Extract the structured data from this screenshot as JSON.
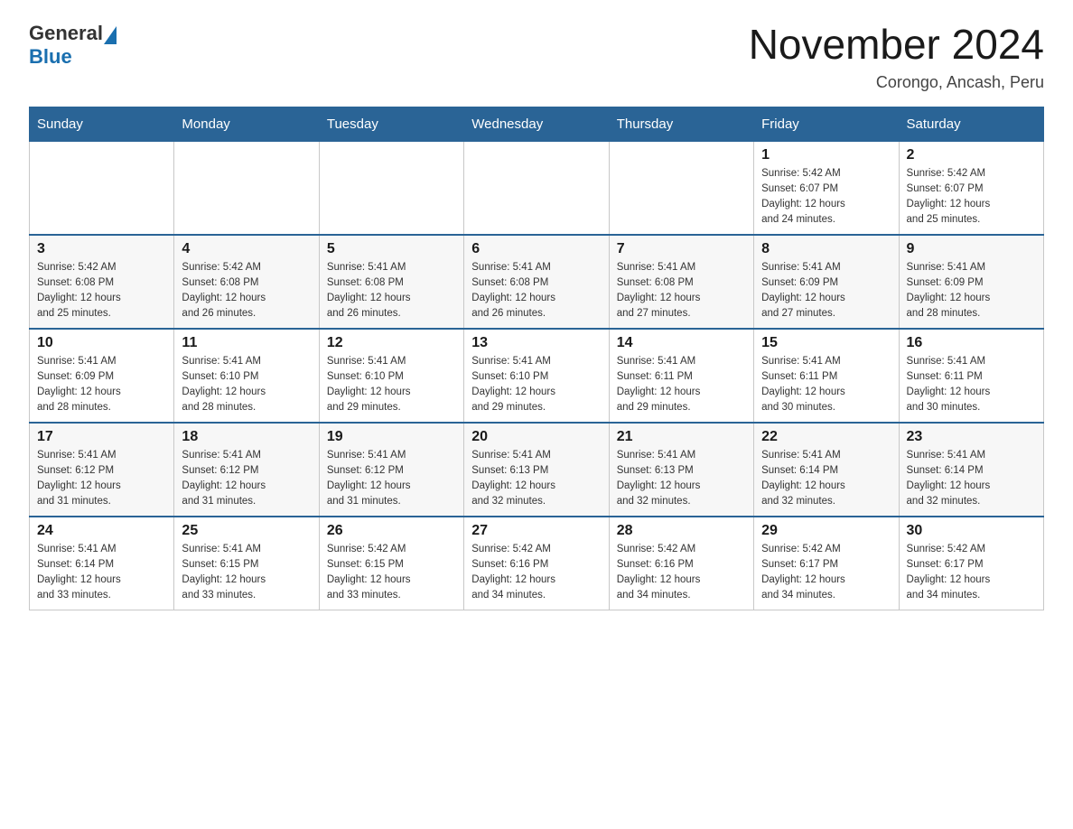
{
  "header": {
    "title": "November 2024",
    "subtitle": "Corongo, Ancash, Peru",
    "logo_general": "General",
    "logo_blue": "Blue"
  },
  "weekdays": [
    "Sunday",
    "Monday",
    "Tuesday",
    "Wednesday",
    "Thursday",
    "Friday",
    "Saturday"
  ],
  "weeks": [
    [
      {
        "day": "",
        "info": ""
      },
      {
        "day": "",
        "info": ""
      },
      {
        "day": "",
        "info": ""
      },
      {
        "day": "",
        "info": ""
      },
      {
        "day": "",
        "info": ""
      },
      {
        "day": "1",
        "info": "Sunrise: 5:42 AM\nSunset: 6:07 PM\nDaylight: 12 hours\nand 24 minutes."
      },
      {
        "day": "2",
        "info": "Sunrise: 5:42 AM\nSunset: 6:07 PM\nDaylight: 12 hours\nand 25 minutes."
      }
    ],
    [
      {
        "day": "3",
        "info": "Sunrise: 5:42 AM\nSunset: 6:08 PM\nDaylight: 12 hours\nand 25 minutes."
      },
      {
        "day": "4",
        "info": "Sunrise: 5:42 AM\nSunset: 6:08 PM\nDaylight: 12 hours\nand 26 minutes."
      },
      {
        "day": "5",
        "info": "Sunrise: 5:41 AM\nSunset: 6:08 PM\nDaylight: 12 hours\nand 26 minutes."
      },
      {
        "day": "6",
        "info": "Sunrise: 5:41 AM\nSunset: 6:08 PM\nDaylight: 12 hours\nand 26 minutes."
      },
      {
        "day": "7",
        "info": "Sunrise: 5:41 AM\nSunset: 6:08 PM\nDaylight: 12 hours\nand 27 minutes."
      },
      {
        "day": "8",
        "info": "Sunrise: 5:41 AM\nSunset: 6:09 PM\nDaylight: 12 hours\nand 27 minutes."
      },
      {
        "day": "9",
        "info": "Sunrise: 5:41 AM\nSunset: 6:09 PM\nDaylight: 12 hours\nand 28 minutes."
      }
    ],
    [
      {
        "day": "10",
        "info": "Sunrise: 5:41 AM\nSunset: 6:09 PM\nDaylight: 12 hours\nand 28 minutes."
      },
      {
        "day": "11",
        "info": "Sunrise: 5:41 AM\nSunset: 6:10 PM\nDaylight: 12 hours\nand 28 minutes."
      },
      {
        "day": "12",
        "info": "Sunrise: 5:41 AM\nSunset: 6:10 PM\nDaylight: 12 hours\nand 29 minutes."
      },
      {
        "day": "13",
        "info": "Sunrise: 5:41 AM\nSunset: 6:10 PM\nDaylight: 12 hours\nand 29 minutes."
      },
      {
        "day": "14",
        "info": "Sunrise: 5:41 AM\nSunset: 6:11 PM\nDaylight: 12 hours\nand 29 minutes."
      },
      {
        "day": "15",
        "info": "Sunrise: 5:41 AM\nSunset: 6:11 PM\nDaylight: 12 hours\nand 30 minutes."
      },
      {
        "day": "16",
        "info": "Sunrise: 5:41 AM\nSunset: 6:11 PM\nDaylight: 12 hours\nand 30 minutes."
      }
    ],
    [
      {
        "day": "17",
        "info": "Sunrise: 5:41 AM\nSunset: 6:12 PM\nDaylight: 12 hours\nand 31 minutes."
      },
      {
        "day": "18",
        "info": "Sunrise: 5:41 AM\nSunset: 6:12 PM\nDaylight: 12 hours\nand 31 minutes."
      },
      {
        "day": "19",
        "info": "Sunrise: 5:41 AM\nSunset: 6:12 PM\nDaylight: 12 hours\nand 31 minutes."
      },
      {
        "day": "20",
        "info": "Sunrise: 5:41 AM\nSunset: 6:13 PM\nDaylight: 12 hours\nand 32 minutes."
      },
      {
        "day": "21",
        "info": "Sunrise: 5:41 AM\nSunset: 6:13 PM\nDaylight: 12 hours\nand 32 minutes."
      },
      {
        "day": "22",
        "info": "Sunrise: 5:41 AM\nSunset: 6:14 PM\nDaylight: 12 hours\nand 32 minutes."
      },
      {
        "day": "23",
        "info": "Sunrise: 5:41 AM\nSunset: 6:14 PM\nDaylight: 12 hours\nand 32 minutes."
      }
    ],
    [
      {
        "day": "24",
        "info": "Sunrise: 5:41 AM\nSunset: 6:14 PM\nDaylight: 12 hours\nand 33 minutes."
      },
      {
        "day": "25",
        "info": "Sunrise: 5:41 AM\nSunset: 6:15 PM\nDaylight: 12 hours\nand 33 minutes."
      },
      {
        "day": "26",
        "info": "Sunrise: 5:42 AM\nSunset: 6:15 PM\nDaylight: 12 hours\nand 33 minutes."
      },
      {
        "day": "27",
        "info": "Sunrise: 5:42 AM\nSunset: 6:16 PM\nDaylight: 12 hours\nand 34 minutes."
      },
      {
        "day": "28",
        "info": "Sunrise: 5:42 AM\nSunset: 6:16 PM\nDaylight: 12 hours\nand 34 minutes."
      },
      {
        "day": "29",
        "info": "Sunrise: 5:42 AM\nSunset: 6:17 PM\nDaylight: 12 hours\nand 34 minutes."
      },
      {
        "day": "30",
        "info": "Sunrise: 5:42 AM\nSunset: 6:17 PM\nDaylight: 12 hours\nand 34 minutes."
      }
    ]
  ]
}
